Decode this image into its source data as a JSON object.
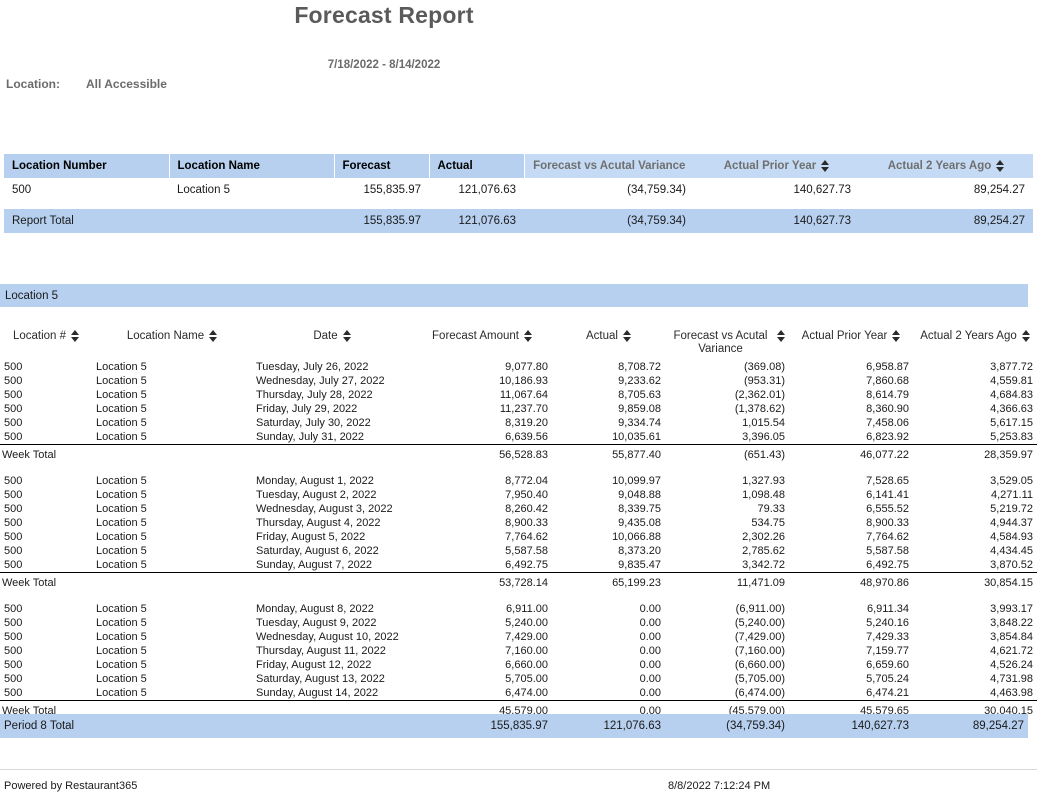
{
  "report": {
    "title": "Forecast Report",
    "date_range": "7/18/2022 - 8/14/2022",
    "filter_label": "Location:",
    "filter_value": "All Accessible"
  },
  "summary": {
    "headers": [
      "Location Number",
      "Location Name",
      "Forecast",
      "Actual",
      "Forecast vs Acutal Variance",
      "Actual Prior Year",
      "Actual 2 Years Ago"
    ],
    "rows": [
      {
        "location_number": "500",
        "location_name": "Location 5",
        "forecast": "155,835.97",
        "actual": "121,076.63",
        "variance": "(34,759.34)",
        "variance_negative": true,
        "prior_year": "140,627.73",
        "two_years_ago": "89,254.27"
      }
    ],
    "total": {
      "label": "Report Total",
      "forecast": "155,835.97",
      "actual": "121,076.63",
      "variance": "(34,759.34)",
      "variance_negative": true,
      "prior_year": "140,627.73",
      "two_years_ago": "89,254.27"
    }
  },
  "location_band": "Location 5",
  "detail": {
    "headers": [
      "Location #",
      "Location Name",
      "Date",
      "Forecast Amount",
      "Actual",
      "Forecast vs Acutal Variance",
      "Actual Prior Year",
      "Actual 2 Years Ago"
    ],
    "weeks": [
      {
        "rows": [
          {
            "location_number": "500",
            "location_name": "Location 5",
            "date": "Tuesday, July 26, 2022",
            "forecast": "9,077.80",
            "actual": "8,708.72",
            "variance": "(369.08)",
            "variance_negative": true,
            "prior_year": "6,958.87",
            "two_years_ago": "3,877.72"
          },
          {
            "location_number": "500",
            "location_name": "Location 5",
            "date": "Wednesday, July 27, 2022",
            "forecast": "10,186.93",
            "actual": "9,233.62",
            "variance": "(953.31)",
            "variance_negative": true,
            "prior_year": "7,860.68",
            "two_years_ago": "4,559.81"
          },
          {
            "location_number": "500",
            "location_name": "Location 5",
            "date": "Thursday, July 28, 2022",
            "forecast": "11,067.64",
            "actual": "8,705.63",
            "variance": "(2,362.01)",
            "variance_negative": true,
            "prior_year": "8,614.79",
            "two_years_ago": "4,684.83"
          },
          {
            "location_number": "500",
            "location_name": "Location 5",
            "date": "Friday, July 29, 2022",
            "forecast": "11,237.70",
            "actual": "9,859.08",
            "variance": "(1,378.62)",
            "variance_negative": true,
            "prior_year": "8,360.90",
            "two_years_ago": "4,366.63"
          },
          {
            "location_number": "500",
            "location_name": "Location 5",
            "date": "Saturday, July 30, 2022",
            "forecast": "8,319.20",
            "actual": "9,334.74",
            "variance": "1,015.54",
            "variance_negative": false,
            "prior_year": "7,458.06",
            "two_years_ago": "5,617.15"
          },
          {
            "location_number": "500",
            "location_name": "Location 5",
            "date": "Sunday, July 31, 2022",
            "forecast": "6,639.56",
            "actual": "10,035.61",
            "variance": "3,396.05",
            "variance_negative": false,
            "prior_year": "6,823.92",
            "two_years_ago": "5,253.83"
          }
        ],
        "total": {
          "label": "Week Total",
          "forecast": "56,528.83",
          "actual": "55,877.40",
          "variance": "(651.43)",
          "variance_negative": true,
          "prior_year": "46,077.22",
          "two_years_ago": "28,359.97"
        }
      },
      {
        "rows": [
          {
            "location_number": "500",
            "location_name": "Location 5",
            "date": "Monday, August 1, 2022",
            "forecast": "8,772.04",
            "actual": "10,099.97",
            "variance": "1,327.93",
            "variance_negative": false,
            "prior_year": "7,528.65",
            "two_years_ago": "3,529.05"
          },
          {
            "location_number": "500",
            "location_name": "Location 5",
            "date": "Tuesday, August 2, 2022",
            "forecast": "7,950.40",
            "actual": "9,048.88",
            "variance": "1,098.48",
            "variance_negative": false,
            "prior_year": "6,141.41",
            "two_years_ago": "4,271.11"
          },
          {
            "location_number": "500",
            "location_name": "Location 5",
            "date": "Wednesday, August 3, 2022",
            "forecast": "8,260.42",
            "actual": "8,339.75",
            "variance": "79.33",
            "variance_negative": false,
            "prior_year": "6,555.52",
            "two_years_ago": "5,219.72"
          },
          {
            "location_number": "500",
            "location_name": "Location 5",
            "date": "Thursday, August 4, 2022",
            "forecast": "8,900.33",
            "actual": "9,435.08",
            "variance": "534.75",
            "variance_negative": false,
            "prior_year": "8,900.33",
            "two_years_ago": "4,944.37"
          },
          {
            "location_number": "500",
            "location_name": "Location 5",
            "date": "Friday, August 5, 2022",
            "forecast": "7,764.62",
            "actual": "10,066.88",
            "variance": "2,302.26",
            "variance_negative": false,
            "prior_year": "7,764.62",
            "two_years_ago": "4,584.93"
          },
          {
            "location_number": "500",
            "location_name": "Location 5",
            "date": "Saturday, August 6, 2022",
            "forecast": "5,587.58",
            "actual": "8,373.20",
            "variance": "2,785.62",
            "variance_negative": false,
            "prior_year": "5,587.58",
            "two_years_ago": "4,434.45"
          },
          {
            "location_number": "500",
            "location_name": "Location 5",
            "date": "Sunday, August 7, 2022",
            "forecast": "6,492.75",
            "actual": "9,835.47",
            "variance": "3,342.72",
            "variance_negative": false,
            "prior_year": "6,492.75",
            "two_years_ago": "3,870.52"
          }
        ],
        "total": {
          "label": "Week Total",
          "forecast": "53,728.14",
          "actual": "65,199.23",
          "variance": "11,471.09",
          "variance_negative": false,
          "prior_year": "48,970.86",
          "two_years_ago": "30,854.15"
        }
      },
      {
        "rows": [
          {
            "location_number": "500",
            "location_name": "Location 5",
            "date": "Monday, August 8, 2022",
            "forecast": "6,911.00",
            "actual": "0.00",
            "variance": "(6,911.00)",
            "variance_negative": true,
            "prior_year": "6,911.34",
            "two_years_ago": "3,993.17"
          },
          {
            "location_number": "500",
            "location_name": "Location 5",
            "date": "Tuesday, August 9, 2022",
            "forecast": "5,240.00",
            "actual": "0.00",
            "variance": "(5,240.00)",
            "variance_negative": true,
            "prior_year": "5,240.16",
            "two_years_ago": "3,848.22"
          },
          {
            "location_number": "500",
            "location_name": "Location 5",
            "date": "Wednesday, August 10, 2022",
            "forecast": "7,429.00",
            "actual": "0.00",
            "variance": "(7,429.00)",
            "variance_negative": true,
            "prior_year": "7,429.33",
            "two_years_ago": "3,854.84"
          },
          {
            "location_number": "500",
            "location_name": "Location 5",
            "date": "Thursday, August 11, 2022",
            "forecast": "7,160.00",
            "actual": "0.00",
            "variance": "(7,160.00)",
            "variance_negative": true,
            "prior_year": "7,159.77",
            "two_years_ago": "4,621.72"
          },
          {
            "location_number": "500",
            "location_name": "Location 5",
            "date": "Friday, August 12, 2022",
            "forecast": "6,660.00",
            "actual": "0.00",
            "variance": "(6,660.00)",
            "variance_negative": true,
            "prior_year": "6,659.60",
            "two_years_ago": "4,526.24"
          },
          {
            "location_number": "500",
            "location_name": "Location 5",
            "date": "Saturday, August 13, 2022",
            "forecast": "5,705.00",
            "actual": "0.00",
            "variance": "(5,705.00)",
            "variance_negative": true,
            "prior_year": "5,705.24",
            "two_years_ago": "4,731.98"
          },
          {
            "location_number": "500",
            "location_name": "Location 5",
            "date": "Sunday, August 14, 2022",
            "forecast": "6,474.00",
            "actual": "0.00",
            "variance": "(6,474.00)",
            "variance_negative": true,
            "prior_year": "6,474.21",
            "two_years_ago": "4,463.98"
          }
        ],
        "total": {
          "label": "Week Total",
          "forecast": "45,579.00",
          "actual": "0.00",
          "variance": "(45,579.00)",
          "variance_negative": true,
          "prior_year": "45,579.65",
          "two_years_ago": "30,040.15"
        }
      }
    ],
    "period_total": {
      "label": "Period 8 Total",
      "forecast": "155,835.97",
      "actual": "121,076.63",
      "variance": "(34,759.34)",
      "variance_negative": true,
      "prior_year": "140,627.73",
      "two_years_ago": "89,254.27"
    }
  },
  "footer": {
    "powered_by": "Powered by Restaurant365",
    "generated": "8/8/2022 7:12:24 PM"
  },
  "colors": {
    "header_blue": "#b7d0ef",
    "header_blue_soft": "#c5dbf5",
    "negative_red": "#fb2e2e",
    "title_gray": "#5a5a5a"
  }
}
